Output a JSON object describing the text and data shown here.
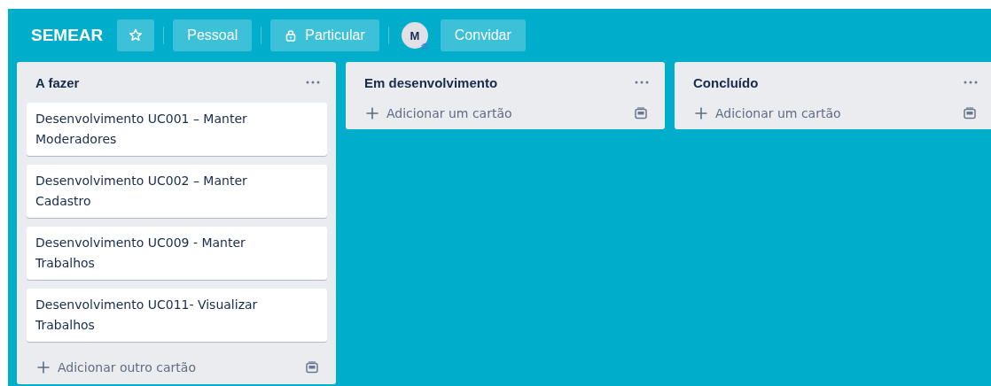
{
  "board": {
    "title": "SEMEAR",
    "starred": false,
    "visibility_team": "Pessoal",
    "visibility": "Particular",
    "member_initial": "M",
    "invite": "Convidar"
  },
  "lists": [
    {
      "title": "A fazer",
      "cards": [
        "Desenvolvimento UC001 – Manter Moderadores",
        "Desenvolvimento UC002 – Manter Cadastro",
        "Desenvolvimento UC009 - Manter Trabalhos",
        "Desenvolvimento UC011- Visualizar Trabalhos"
      ],
      "add_label": "Adicionar outro cartão"
    },
    {
      "title": "Em desenvolvimento",
      "add_label": "Adicionar um cartão"
    },
    {
      "title": "Concluído",
      "add_label": "Adicionar um cartão"
    }
  ]
}
